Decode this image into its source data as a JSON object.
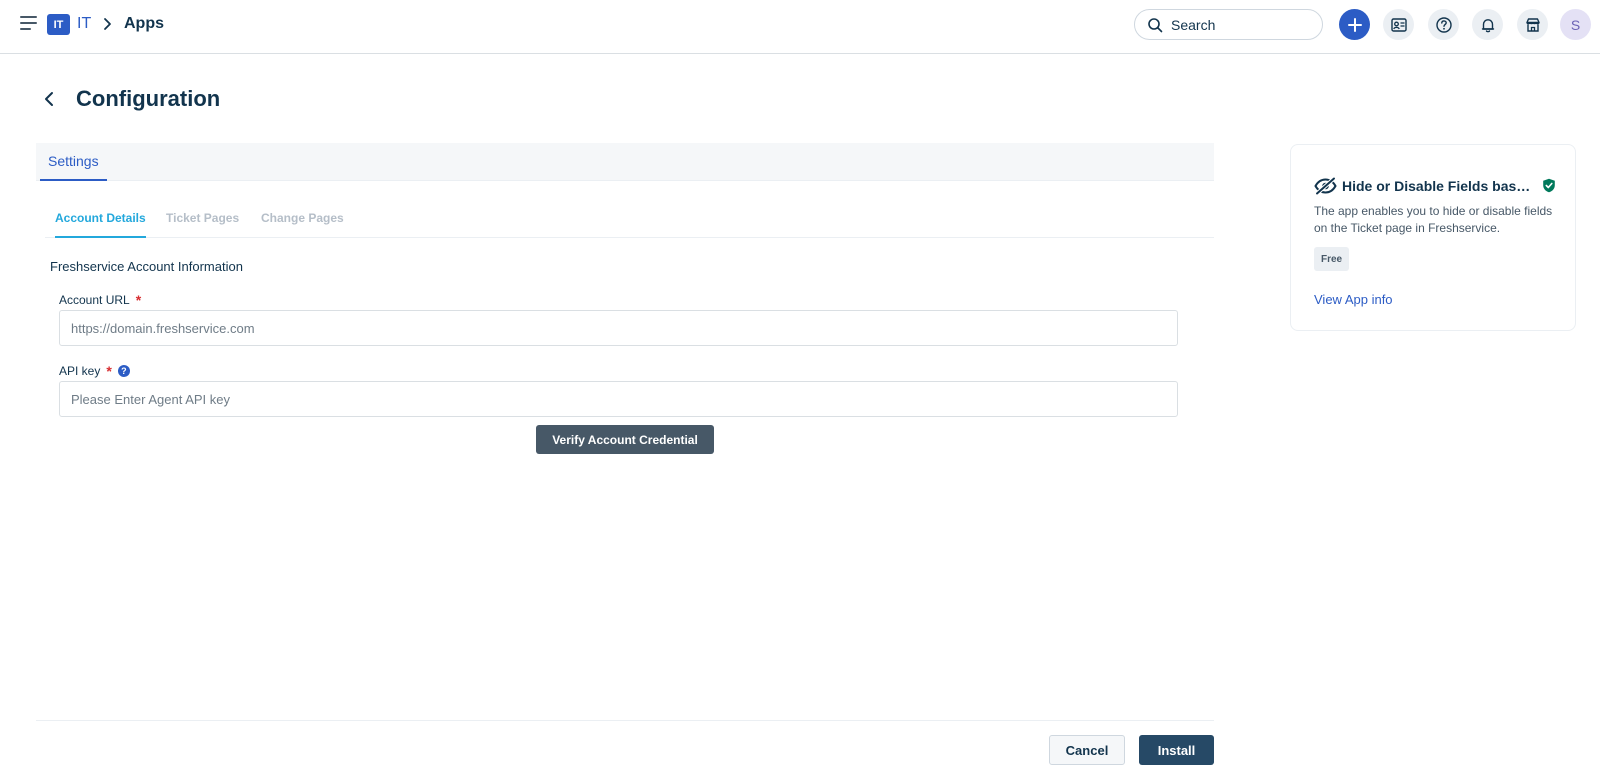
{
  "header": {
    "workspace_badge": "IT",
    "workspace_name": "IT",
    "breadcrumb_page": "Apps",
    "search_label": "Search",
    "avatar_initial": "S"
  },
  "page": {
    "title": "Configuration"
  },
  "settings": {
    "tab_label": "Settings",
    "subtabs": [
      {
        "label": "Account Details",
        "active": true
      },
      {
        "label": "Ticket Pages",
        "active": false
      },
      {
        "label": "Change Pages",
        "active": false
      }
    ],
    "section_title": "Freshservice Account Information",
    "account_url": {
      "label": "Account URL",
      "required_marker": "*",
      "value": "",
      "placeholder": "https://domain.freshservice.com"
    },
    "api_key": {
      "label": "API key",
      "required_marker": "*",
      "help_glyph": "?",
      "value": "",
      "placeholder": "Please Enter Agent API key"
    },
    "verify_label": "Verify Account Credential"
  },
  "footer": {
    "cancel_label": "Cancel",
    "install_label": "Install"
  },
  "app_card": {
    "name": "Hide or Disable Fields base...",
    "description": "The app enables you to hide or disable fields on the Ticket page in Freshservice.",
    "price": "Free",
    "link_label": "View App info"
  },
  "colors": {
    "primary": "#2c5cc5",
    "active_subtab": "#23a8dc",
    "required": "#d72d30",
    "verified": "#00795b",
    "install_button": "#264966"
  },
  "icons": {
    "menu": "hamburger-icon",
    "breadcrumb_separator": "chevron-right-icon",
    "search": "search-icon",
    "add": "plus-icon",
    "contacts": "contact-card-icon",
    "help": "help-circle-icon",
    "notifications": "bell-icon",
    "marketplace": "store-icon",
    "back": "chevron-left-icon",
    "app": "eye-off-icon",
    "verified": "shield-check-icon"
  }
}
